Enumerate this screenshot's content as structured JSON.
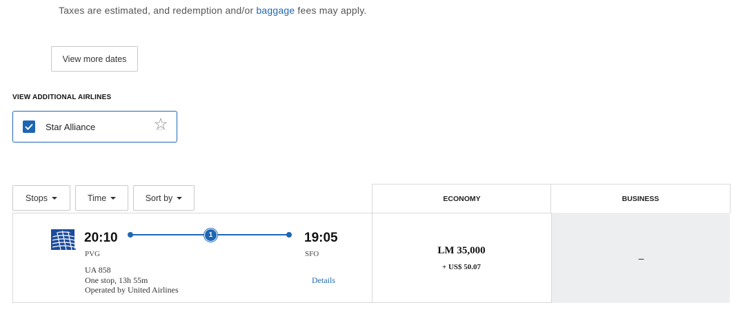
{
  "disclaimer": {
    "before": "Taxes are estimated, and redemption and/or ",
    "link": "baggage",
    "after": " fees may apply."
  },
  "view_more_dates": "View more dates",
  "additional_airlines": {
    "heading": "VIEW ADDITIONAL AIRLINES",
    "option_label": "Star Alliance",
    "checked": true
  },
  "filters": {
    "stops": "Stops",
    "time": "Time",
    "sort_by": "Sort by"
  },
  "columns": {
    "economy": "ECONOMY",
    "business": "BUSINESS"
  },
  "flight": {
    "depart_time": "20:10",
    "depart_airport": "PVG",
    "arrive_time": "19:05",
    "arrive_airport": "SFO",
    "stops_count": "1",
    "flight_number": "UA 858",
    "duration": "One stop, 13h 55m",
    "operator": "Operated by United Airlines",
    "details": "Details",
    "economy_price": "LM 35,000",
    "economy_tax": "+ US$ 50.07",
    "business_price": "–"
  },
  "colors": {
    "accent": "#1d66b3",
    "business_bg": "#eceeef"
  }
}
